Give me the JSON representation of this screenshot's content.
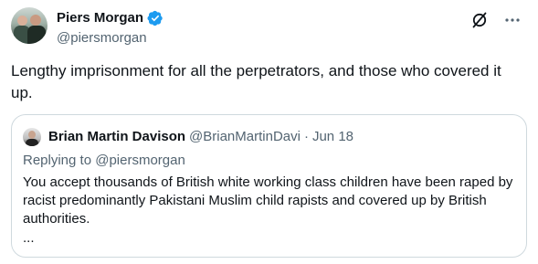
{
  "author": {
    "display_name": "Piers Morgan",
    "handle": "@piersmorgan",
    "verified_icon": "verified-badge-icon",
    "avatar_icon": "avatar"
  },
  "actions": {
    "grok_icon": "grok-icon",
    "more_icon": "more-options-icon"
  },
  "tweet": {
    "text": "Lengthy imprisonment for all the perpetrators, and those who covered it up."
  },
  "quote": {
    "display_name": "Brian Martin Davison",
    "handle": "@BrianMartinDavi",
    "separator": "·",
    "date": "Jun 18",
    "replying_prefix": "Replying to ",
    "replying_to": "@piersmorgan",
    "body": "You accept thousands of British white working class children have been raped by racist predominantly Pakistani Muslim child rapists and covered up by British authorities.",
    "more": "..."
  },
  "colors": {
    "text_primary": "#0f1419",
    "text_secondary": "#536471",
    "verified_blue": "#1d9bf0",
    "border": "#cfd9de"
  }
}
